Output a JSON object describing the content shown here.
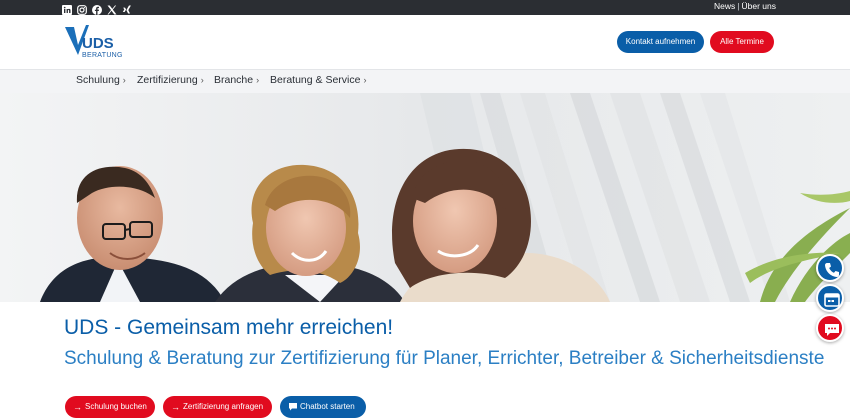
{
  "topbar": {
    "social_icons": [
      "linkedin-icon",
      "instagram-icon",
      "facebook-icon",
      "x-icon",
      "xing-icon"
    ],
    "links": [
      "News",
      "Über uns"
    ],
    "separator": "|"
  },
  "header": {
    "logo_text": "UDS",
    "logo_subtext": "BERATUNG",
    "contact_button": "Kontakt aufnehmen",
    "events_button": "Alle Termine"
  },
  "nav": {
    "items": [
      {
        "label": "Schulung"
      },
      {
        "label": "Zertifizierung"
      },
      {
        "label": "Branche"
      },
      {
        "label": "Beratung & Service"
      }
    ],
    "chevron": "›"
  },
  "hero": {
    "image": "team-photo"
  },
  "content": {
    "headline": "UDS - Gemeinsam mehr erreichen!",
    "subline": "Schulung & Beratung zur Zertifizierung für Planer, Errichter, Betreiber & Sicherheitsdienste",
    "cta": {
      "book_training": "Schulung buchen",
      "request_certification": "Zertifizierung anfragen",
      "start_chatbot": "Chatbot starten"
    }
  },
  "floating": [
    "phone-icon",
    "calendar-icon",
    "chat-icon"
  ],
  "colors": {
    "brand_blue": "#0a5ea8",
    "accent_red": "#e10b1f",
    "topbar_dark": "#2b2e33"
  }
}
